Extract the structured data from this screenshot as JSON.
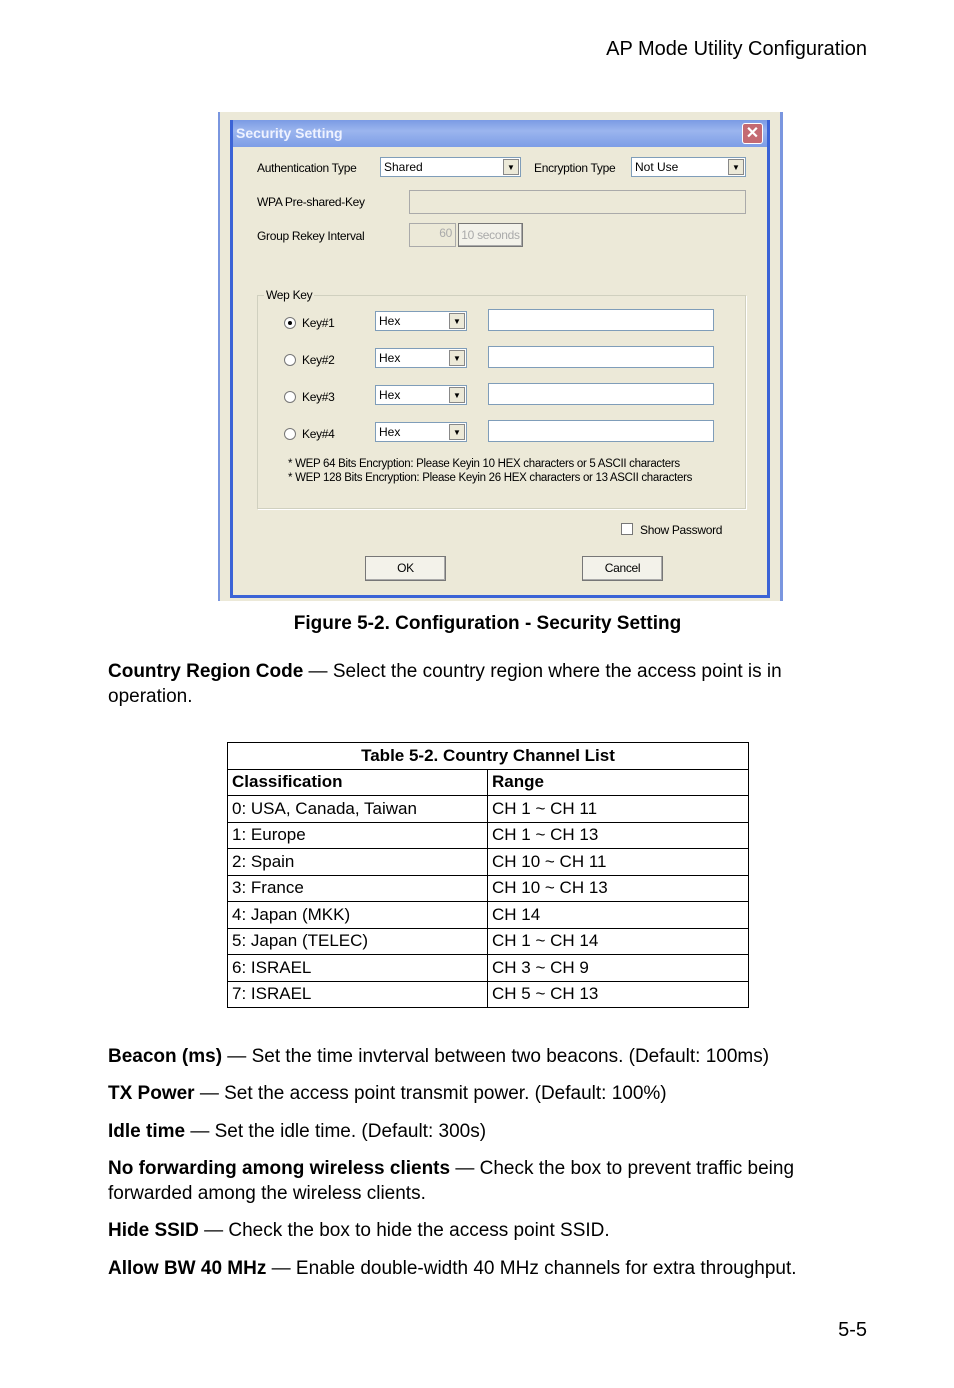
{
  "header": "AP Mode Utility Configuration",
  "dialog": {
    "title": "Security Setting",
    "auth_label": "Authentication Type",
    "auth_value": "Shared",
    "enc_label": "Encryption Type",
    "enc_value": "Not Use",
    "wpa_label": "WPA Pre-shared-Key",
    "rekey_label": "Group Rekey Interval",
    "rekey_value": "60",
    "rekey_unit": "10 seconds",
    "wep_group": "Wep Key",
    "keys": [
      {
        "label": "Key#1",
        "format": "Hex",
        "selected": true
      },
      {
        "label": "Key#2",
        "format": "Hex",
        "selected": false
      },
      {
        "label": "Key#3",
        "format": "Hex",
        "selected": false
      },
      {
        "label": "Key#4",
        "format": "Hex",
        "selected": false
      }
    ],
    "note1": "* WEP 64 Bits Encryption:  Please Keyin 10 HEX characters or 5 ASCII characters",
    "note2": "* WEP 128 Bits Encryption:  Please Keyin 26 HEX characters or 13 ASCII characters",
    "show_password": "Show Password",
    "ok": "OK",
    "cancel": "Cancel"
  },
  "caption": "Figure 5-2.  Configuration - Security Setting",
  "crc": {
    "term": "Country Region Code",
    "text": " — Select the country region where the access point is in operation."
  },
  "table": {
    "title": "Table 5-2. Country Channel List",
    "headers": [
      "Classification",
      "Range"
    ],
    "rows": [
      [
        "0: USA, Canada, Taiwan",
        "CH 1 ~ CH 11"
      ],
      [
        "1: Europe",
        "CH 1 ~ CH 13"
      ],
      [
        "2: Spain",
        "CH 10 ~ CH 11"
      ],
      [
        "3: France",
        "CH 10 ~ CH 13"
      ],
      [
        "4: Japan (MKK)",
        "CH 14"
      ],
      [
        "5: Japan (TELEC)",
        "CH 1 ~ CH 14"
      ],
      [
        "6: ISRAEL",
        "CH 3 ~ CH 9"
      ],
      [
        "7: ISRAEL",
        "CH 5 ~ CH 13"
      ]
    ]
  },
  "defs": [
    {
      "term": "Beacon (ms)",
      "text": " — Set the time invterval between two beacons. (Default: 100ms)"
    },
    {
      "term": "TX Power",
      "text": " — Set the access point transmit power. (Default: 100%)"
    },
    {
      "term": "Idle time",
      "text": " — Set the idle time. (Default: 300s)"
    },
    {
      "term": "No forwarding among wireless clients",
      "text": " — Check the box to prevent traffic being forwarded among the wireless clients."
    },
    {
      "term": "Hide SSID",
      "text": " — Check the box to hide the access point SSID."
    },
    {
      "term": "Allow BW 40 MHz",
      "text": " — Enable double-width 40 MHz channels for extra throughput."
    }
  ],
  "page_number": "5-5"
}
